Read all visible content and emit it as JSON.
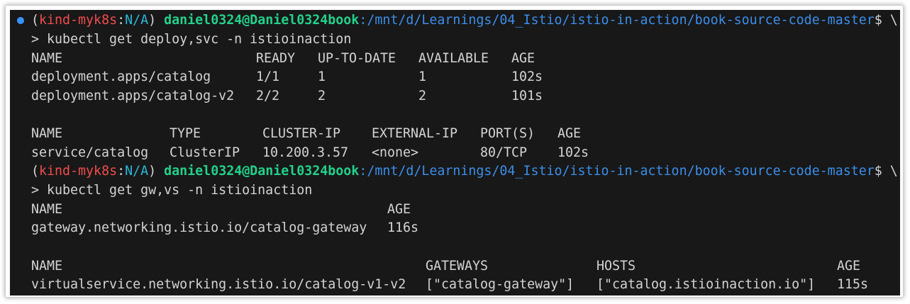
{
  "colors": {
    "background": "#181818",
    "text": "#d4d4d4",
    "prompt_user": "#23d18b",
    "prompt_path": "#3b8eea",
    "prompt_context": "#f14c4c",
    "prompt_namespace": "#29b8db",
    "status_dot": "#3794ff"
  },
  "status_icon": "circle-dot-icon",
  "prompt1": {
    "open": "(",
    "context": "kind-myk8s",
    "colon": ":",
    "namespace": "N/A",
    "close": ")",
    "user_host": "daniel0324@Daniel0324book",
    "path": ":/mnt/d/Learnings/04_Istio/istio-in-action/book-source-code-master",
    "suffix": "$ \\"
  },
  "command1": "> kubectl get deploy,svc -n istioinaction",
  "deploy_table": {
    "headers": [
      "NAME",
      "READY",
      "UP-TO-DATE",
      "AVAILABLE",
      "AGE"
    ],
    "rows": [
      [
        "deployment.apps/catalog",
        "1/1",
        "1",
        "1",
        "102s"
      ],
      [
        "deployment.apps/catalog-v2",
        "2/2",
        "2",
        "2",
        "101s"
      ]
    ]
  },
  "svc_table": {
    "headers": [
      "NAME",
      "TYPE",
      "CLUSTER-IP",
      "EXTERNAL-IP",
      "PORT(S)",
      "AGE"
    ],
    "rows": [
      [
        "service/catalog",
        "ClusterIP",
        "10.200.3.57",
        "<none>",
        "80/TCP",
        "102s"
      ]
    ]
  },
  "prompt2": {
    "open": "(",
    "context": "kind-myk8s",
    "colon": ":",
    "namespace": "N/A",
    "close": ")",
    "user_host": "daniel0324@Daniel0324book",
    "path": ":/mnt/d/Learnings/04_Istio/istio-in-action/book-source-code-master",
    "suffix": "$ \\"
  },
  "command2": "> kubectl get gw,vs -n istioinaction",
  "gw_table": {
    "headers": [
      "NAME",
      "AGE"
    ],
    "rows": [
      [
        "gateway.networking.istio.io/catalog-gateway",
        "116s"
      ]
    ]
  },
  "vs_table": {
    "headers": [
      "NAME",
      "GATEWAYS",
      "HOSTS",
      "AGE"
    ],
    "rows": [
      [
        "virtualservice.networking.istio.io/catalog-v1-v2",
        "[\"catalog-gateway\"]",
        "[\"catalog.istioinaction.io\"]",
        "115s"
      ]
    ]
  }
}
